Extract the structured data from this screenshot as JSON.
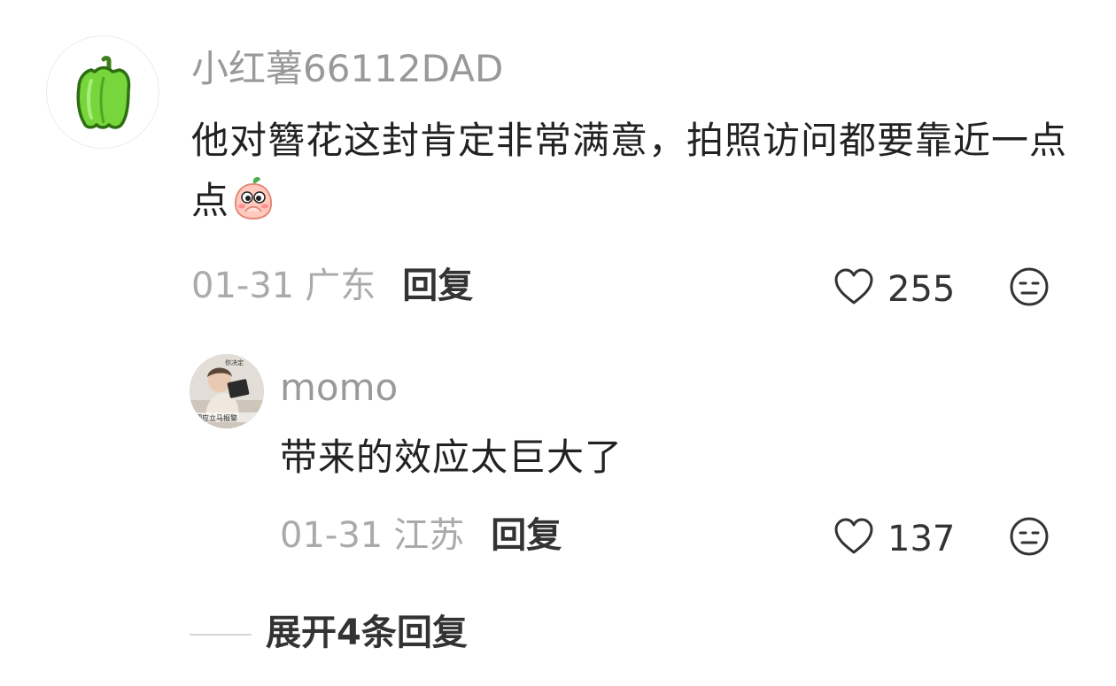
{
  "comment": {
    "username": "小红薯66112DAD",
    "content": "他对簪花这封肯定非常满意，拍照访问都要靠近一点点",
    "emoji": "shy-peach-emoji",
    "date": "01-31",
    "location": "广东",
    "reply_label": "回复",
    "likes": "255",
    "avatar_icon": "green-pepper-icon"
  },
  "reply": {
    "username": "momo",
    "content": "带来的效应太巨大了",
    "date": "01-31",
    "location": "江苏",
    "reply_label": "回复",
    "likes": "137",
    "avatar_sticker_text": [
      "你决定",
      "吧应立马报警"
    ]
  },
  "expand": {
    "label": "展开4条回复"
  },
  "icons": {
    "like": "heart-outline-icon",
    "dislike": "meh-face-icon"
  }
}
